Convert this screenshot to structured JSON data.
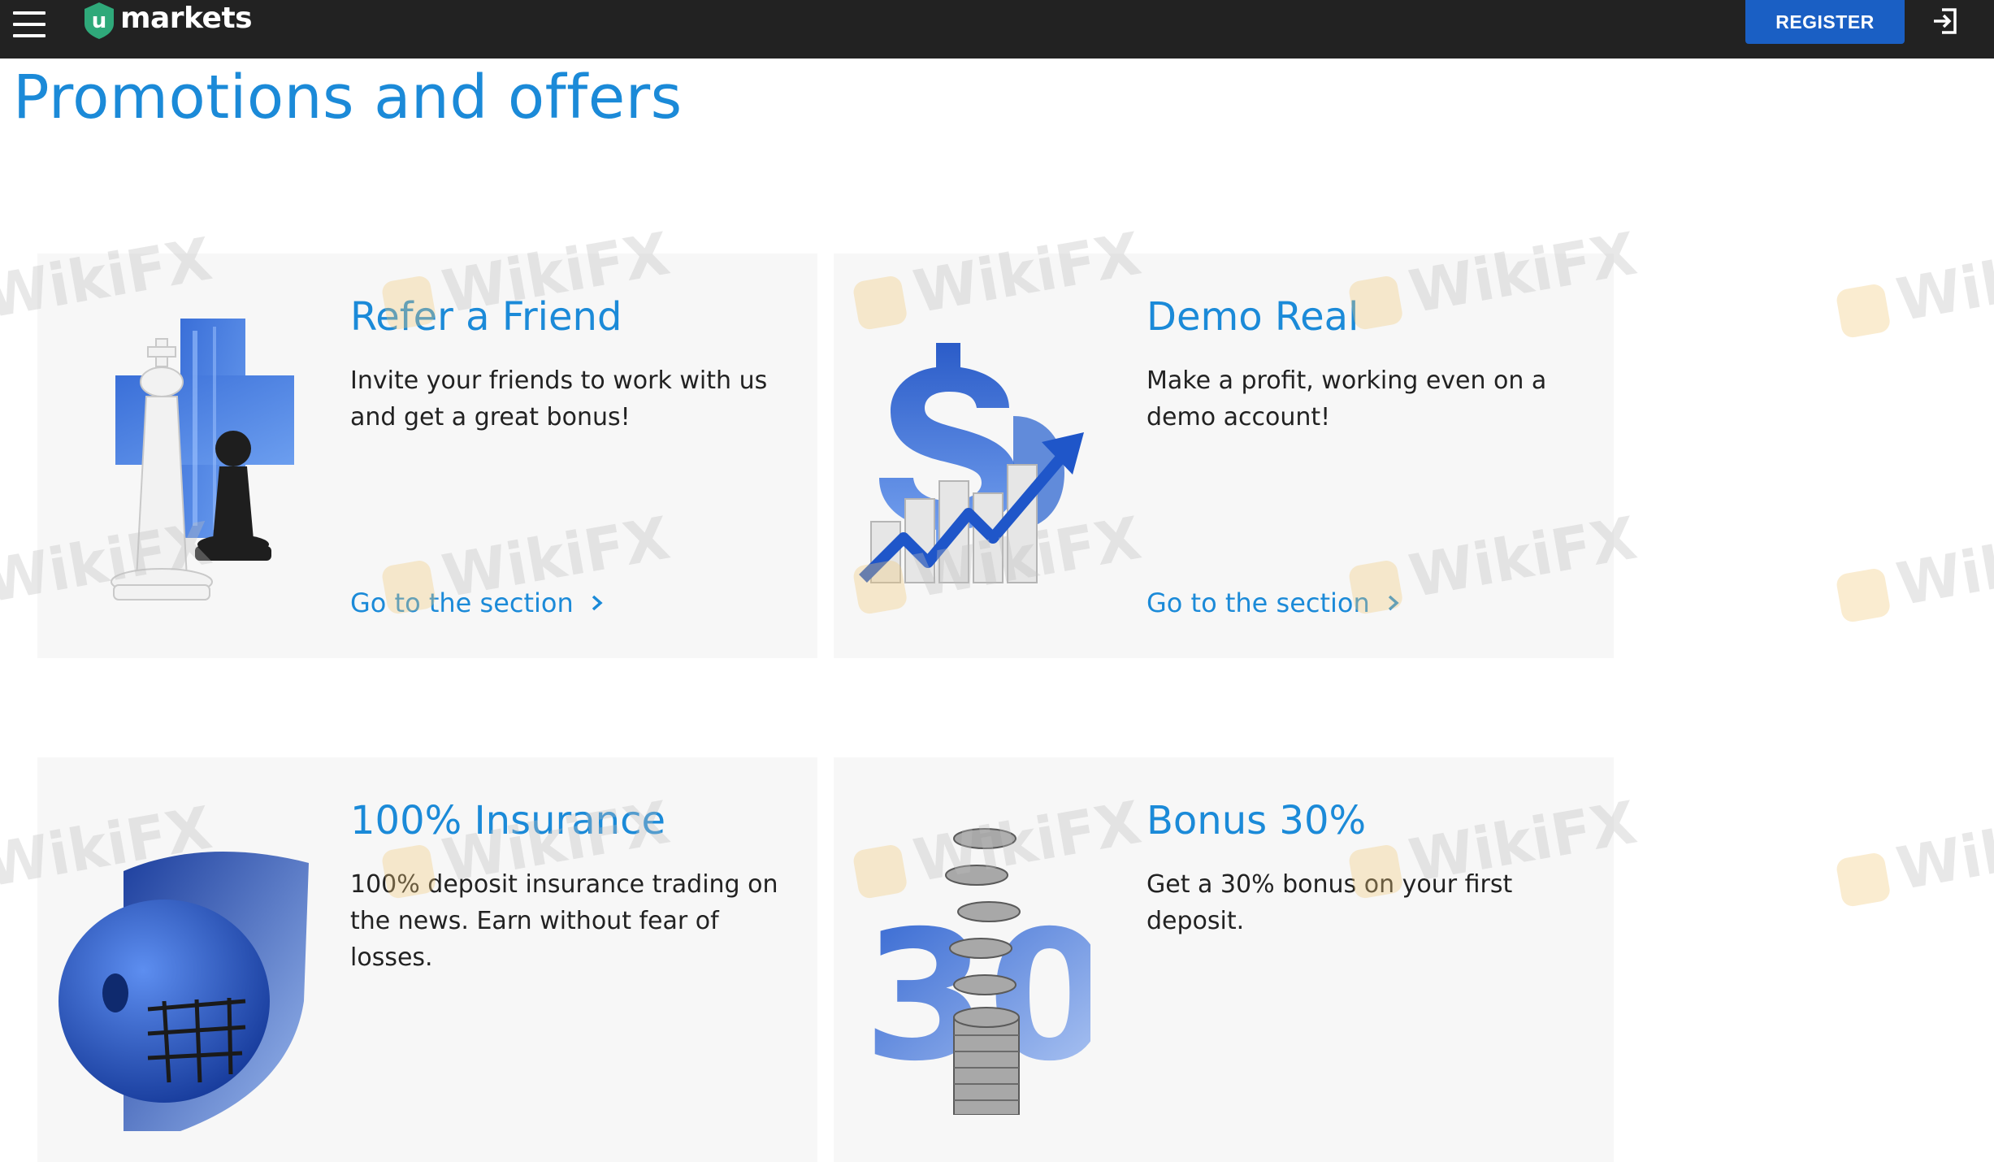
{
  "header": {
    "menu_icon": "hamburger-menu-icon",
    "logo_mark": "u",
    "logo_text": "markets",
    "register_label": "REGISTER",
    "login_icon": "login-arrow-icon",
    "brand_color": "#1a5fc4",
    "bar_color": "#222222"
  },
  "page": {
    "title": "Promotions and offers",
    "accent_color": "#1b8ad8"
  },
  "promotions": [
    {
      "title": "Refer a Friend",
      "description": "Invite your friends to work with us and get a great bonus!",
      "link": "Go to the section",
      "image": "chess-pieces-image"
    },
    {
      "title": "Demo Real",
      "description": "Make a profit, working even on a demo account!",
      "link": "Go to the section",
      "image": "dollar-growth-chart-image"
    },
    {
      "title": "100% Insurance",
      "description": "100% deposit insurance trading on the news. Earn without fear of losses.",
      "image": "hockey-helmet-shield-image"
    },
    {
      "title": "Bonus 30%",
      "description": "Get a 30% bonus on your first deposit.",
      "image": "coins-thirty-image"
    }
  ],
  "watermark": {
    "text": "WikiFX"
  }
}
